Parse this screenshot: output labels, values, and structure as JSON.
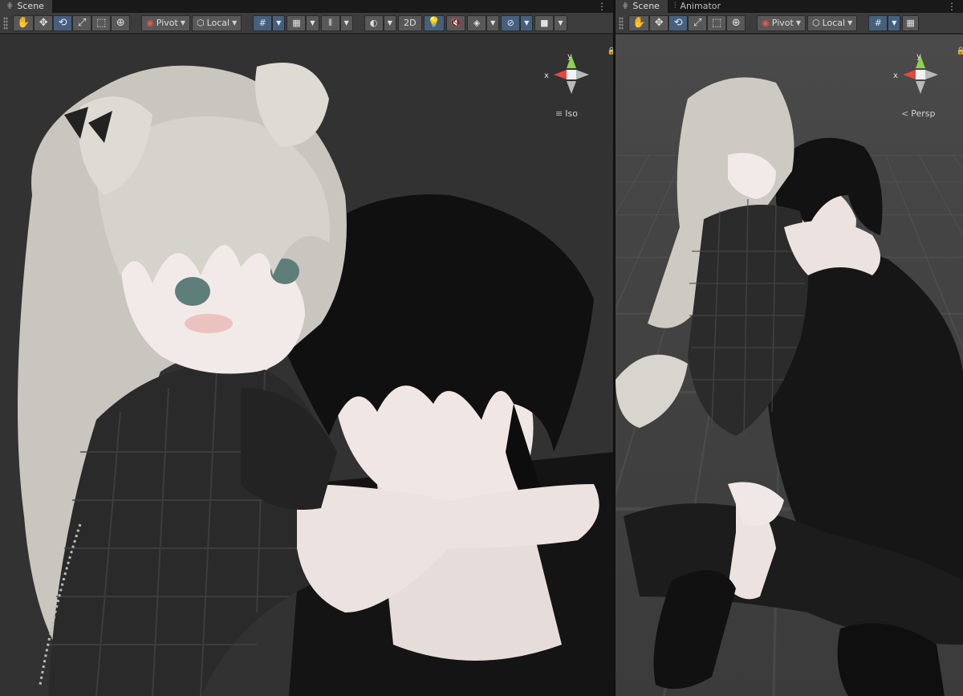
{
  "left_panel": {
    "tabs": [
      {
        "label": "Scene",
        "icon": "grid-icon"
      }
    ],
    "toolbar": {
      "tools": [
        "hand-tool-icon",
        "move-tool-icon",
        "rotate-tool-icon",
        "scale-tool-icon",
        "rect-tool-icon",
        "transform-tool-icon"
      ],
      "active_tool": "rotate-tool-icon",
      "pivot_label": "Pivot",
      "space_label": "Local",
      "mode_2d_label": "2D"
    },
    "gizmo": {
      "x_label": "x",
      "y_label": "y"
    },
    "projection_label": "Iso"
  },
  "right_panel": {
    "tabs": [
      {
        "label": "Scene",
        "icon": "grid-icon"
      },
      {
        "label": "Animator",
        "icon": "animator-icon"
      }
    ],
    "toolbar": {
      "tools": [
        "hand-tool-icon",
        "move-tool-icon",
        "rotate-tool-icon",
        "scale-tool-icon",
        "rect-tool-icon",
        "transform-tool-icon"
      ],
      "active_tool": "rotate-tool-icon",
      "pivot_label": "Pivot",
      "space_label": "Local"
    },
    "gizmo": {
      "x_label": "x",
      "y_label": "y"
    },
    "projection_label": "Persp"
  },
  "colors": {
    "x_axis": "#e24a3c",
    "y_axis": "#8fd14f",
    "active_button": "#46607c",
    "toolbar_bg": "#3c3c3c"
  }
}
